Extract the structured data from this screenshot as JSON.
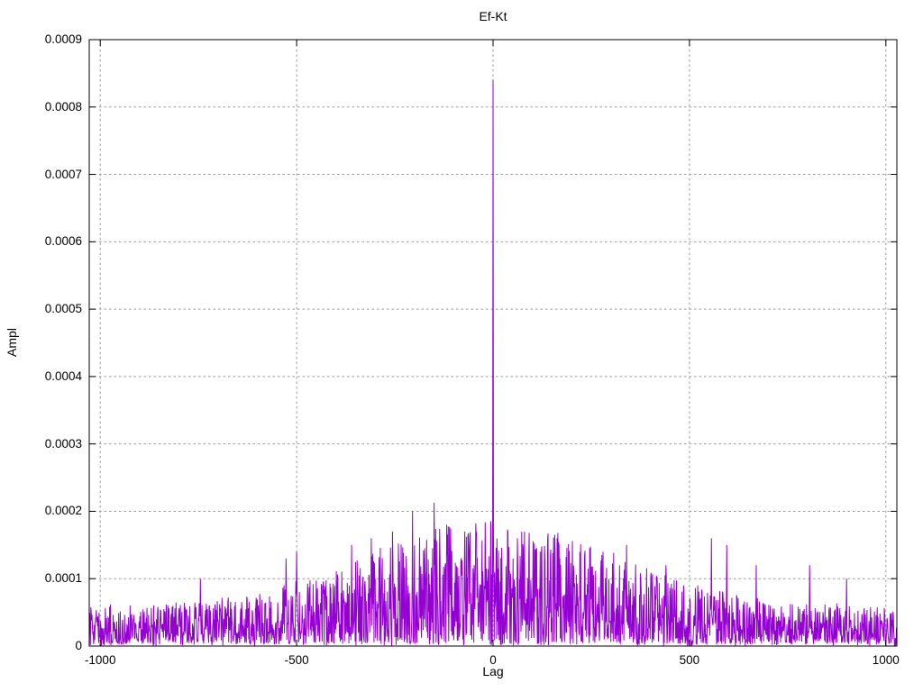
{
  "chart_data": {
    "type": "line",
    "title": "Ef-Kt",
    "xlabel": "Lag",
    "ylabel": "Ampl",
    "xlim": [
      -1028,
      1028
    ],
    "ylim": [
      0,
      0.0009
    ],
    "grid": true,
    "legend": "none",
    "background_color": "#ffffff",
    "grid_color": "#999999",
    "border_color": "#000000",
    "xtick_values": [
      -1000,
      -500,
      0,
      500,
      1000
    ],
    "xtick_labels": [
      "-1000",
      "-500",
      "0",
      "500",
      "1000"
    ],
    "ytick_values": [
      0,
      0.0001,
      0.0002,
      0.0003,
      0.0004,
      0.0005,
      0.0006,
      0.0007,
      0.0008,
      0.0009
    ],
    "ytick_labels": [
      "0",
      "0.0001",
      "0.0002",
      "0.0003",
      "0.0004",
      "0.0005",
      "0.0006",
      "0.0007",
      "0.0008",
      "0.0009"
    ],
    "series": [
      {
        "name": "Ef-Kt",
        "style": "lines",
        "color": "#9400d3",
        "lag_min": -1028,
        "lag_max": 1028,
        "points_per_lag": 1,
        "main_peak": {
          "lag": 0,
          "value": 0.00084
        },
        "noise_envelope": {
          "base": 5.5e-05,
          "amp": 0.00013,
          "gauss_width": 450,
          "power": 1.7,
          "jitter": 6e-06
        },
        "seed": 90210,
        "notable_peaks": [
          [
            -150,
            0.000213
          ],
          [
            -205,
            0.0002
          ],
          [
            -118,
            0.00018
          ],
          [
            -256,
            0.00017
          ],
          [
            -310,
            0.00016
          ],
          [
            -360,
            0.00015
          ],
          [
            -500,
            0.00014
          ],
          [
            -527,
            0.00013
          ],
          [
            -60,
            0.00014
          ],
          [
            -745,
            0.0001
          ],
          [
            62,
            0.00016
          ],
          [
            120,
            0.00014
          ],
          [
            170,
            0.00013
          ],
          [
            340,
            0.00015
          ],
          [
            440,
            0.00012
          ],
          [
            556,
            0.00016
          ],
          [
            595,
            0.00015
          ],
          [
            670,
            0.00012
          ],
          [
            806,
            0.00012
          ],
          [
            900,
            0.0001
          ]
        ]
      }
    ]
  }
}
